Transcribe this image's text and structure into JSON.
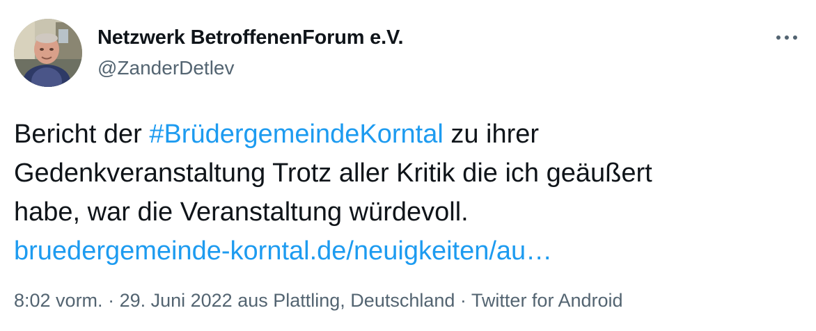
{
  "author": {
    "display_name": "Netzwerk BetroffenenForum e.V.",
    "handle": "@ZanderDetlev"
  },
  "tweet": {
    "line1_before": "Bericht der ",
    "hashtag": "#BrüdergemeindeKorntal",
    "line1_after": " zu ihrer",
    "line2": "Gedenkveranstaltung Trotz aller Kritik die ich geäußert",
    "line3": "habe, war die Veranstaltung würdevoll.",
    "link": "bruedergemeinde-korntal.de/neuigkeiten/au…"
  },
  "meta": {
    "time": "8:02 vorm.",
    "separator": " · ",
    "date": "29. Juni 2022",
    "location_prefix": " aus ",
    "location": "Plattling, Deutschland",
    "source": "Twitter for Android"
  },
  "icons": {
    "more": "more-horizontal-icon"
  },
  "colors": {
    "link": "#1d9bf0",
    "secondary_text": "#536471",
    "primary_text": "#0f1419"
  }
}
